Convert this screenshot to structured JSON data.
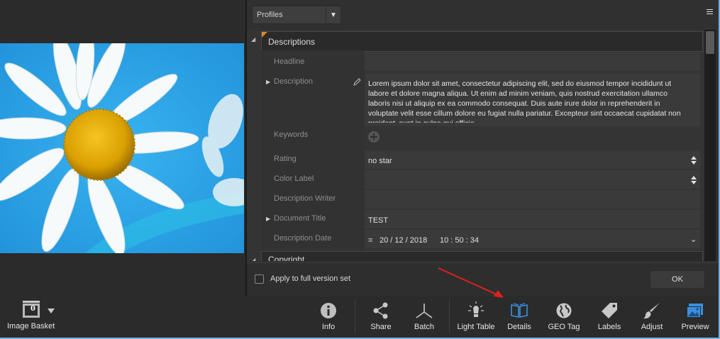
{
  "profiles": {
    "label": "Profiles"
  },
  "sections": {
    "descriptions": "Descriptions",
    "copyright": "Copyright"
  },
  "fields": {
    "headline": {
      "label": "Headline",
      "value": ""
    },
    "description": {
      "label": "Description",
      "value": "Lorem ipsum dolor sit amet, consectetur adipiscing elit, sed do eiusmod tempor incididunt ut labore et dolore magna aliqua. Ut enim ad minim veniam, quis nostrud exercitation ullamco laboris nisi ut aliquip ex ea commodo consequat. Duis aute irure dolor in reprehenderit in voluptate velit esse cillum dolore eu fugiat nulla pariatur. Excepteur sint occaecat cupidatat non proident, sunt in culpa qui officia"
    },
    "keywords": {
      "label": "Keywords"
    },
    "rating": {
      "label": "Rating",
      "value": "no star"
    },
    "color_label": {
      "label": "Color Label",
      "value": ""
    },
    "description_writer": {
      "label": "Description Writer",
      "value": ""
    },
    "document_title": {
      "label": "Document Title",
      "value": "TEST"
    },
    "description_date": {
      "label": "Description Date",
      "date": "20 / 12 / 2018",
      "time": "10 : 50 : 34"
    }
  },
  "apply": {
    "label": "Apply to full version set",
    "checked": false
  },
  "ok_button": "OK",
  "basket": {
    "count": "0",
    "label": "Image Basket"
  },
  "toolbar": [
    {
      "name": "info",
      "label": "Info",
      "icon": "info-icon"
    },
    {
      "name": "share",
      "label": "Share",
      "icon": "share-icon"
    },
    {
      "name": "batch",
      "label": "Batch",
      "icon": "batch-icon"
    },
    {
      "name": "light-table",
      "label": "Light Table",
      "icon": "lightbulb-icon"
    },
    {
      "name": "details",
      "label": "Details",
      "icon": "book-icon",
      "active": true
    },
    {
      "name": "geo-tag",
      "label": "GEO Tag",
      "icon": "globe-icon"
    },
    {
      "name": "labels",
      "label": "Labels",
      "icon": "tag-icon"
    },
    {
      "name": "adjust",
      "label": "Adjust",
      "icon": "brush-icon"
    },
    {
      "name": "preview",
      "label": "Preview",
      "icon": "preview-icon",
      "active": true
    }
  ],
  "colors": {
    "accent_blue": "#3a8fe0",
    "annotation_red": "#e0201e",
    "section_marker": "#d98a23"
  }
}
